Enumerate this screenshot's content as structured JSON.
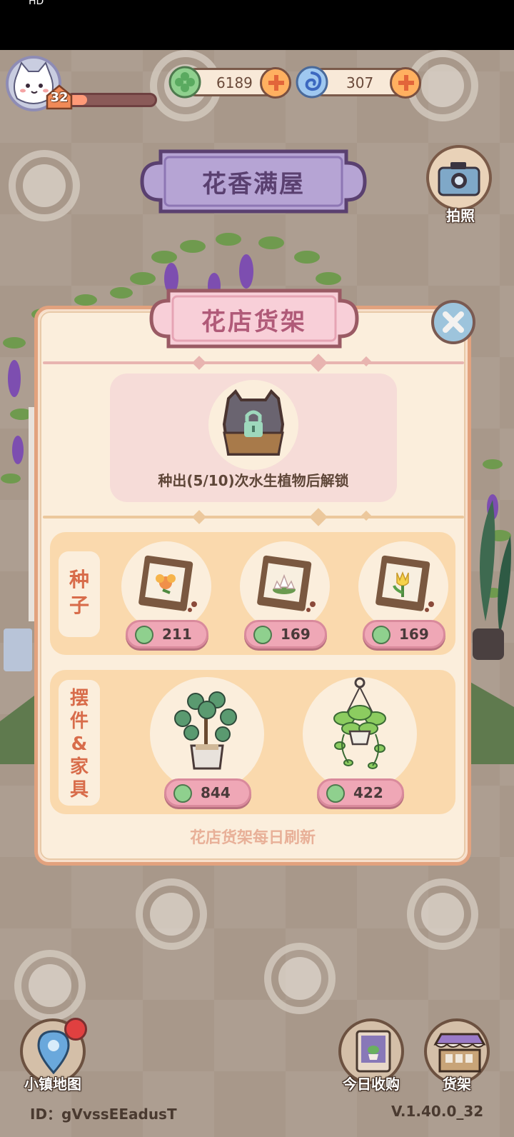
{
  "status_bar": {
    "indicator": "HD"
  },
  "player": {
    "level": "32",
    "xp_fraction": 0.22
  },
  "currencies": [
    {
      "name": "clover-coin",
      "value": "6189"
    },
    {
      "name": "blue-swirl-gem",
      "value": "307"
    }
  ],
  "location_title": "花香满屋",
  "camera": {
    "label": "拍照"
  },
  "modal": {
    "title": "花店货架",
    "locked": {
      "text": "种出(5/10)次水生植物后解锁"
    },
    "seeds": {
      "label": "种子",
      "items": [
        {
          "icon": "marigold-seed-packet-icon",
          "price": "211"
        },
        {
          "icon": "water-lily-seed-packet-icon",
          "price": "169"
        },
        {
          "icon": "tulip-seed-packet-icon",
          "price": "169"
        }
      ]
    },
    "decor": {
      "label": "摆件&家具",
      "items": [
        {
          "icon": "potted-plant-icon",
          "price": "844"
        },
        {
          "icon": "hanging-plant-icon",
          "price": "422"
        }
      ]
    },
    "refresh_note": "花店货架每日刷新"
  },
  "bottom": {
    "map_label": "小镇地图",
    "buy_label": "今日收购",
    "shelf_label": "货架",
    "user_id": "ID：gVvssEEadusT",
    "version": "V.1.40.0_32"
  },
  "colors": {
    "accent_pink": "#efa7b6",
    "panel_bg": "#fbeedc",
    "seed_row_bg": "#fad9ad",
    "title_purple": "#5a4070"
  }
}
